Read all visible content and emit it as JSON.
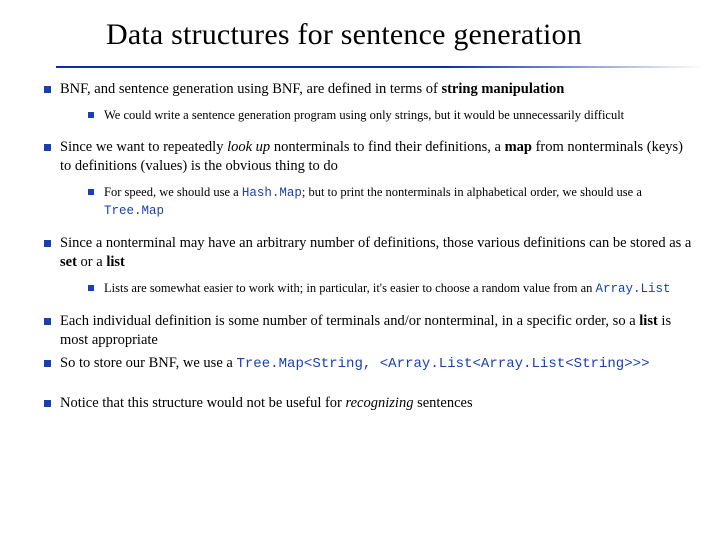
{
  "title": "Data structures for sentence generation",
  "bullets": {
    "b1": {
      "text_a": "BNF, and sentence generation using BNF, are defined in terms of ",
      "text_b": "string manipulation",
      "sub": "We could write a sentence generation program using only strings, but it would be unnecessarily difficult"
    },
    "b2": {
      "text_a": "Since we want to repeatedly ",
      "text_em": "look up",
      "text_b": " nonterminals to find their definitions, a ",
      "text_bold": "map",
      "text_c": " from nonterminals (keys) to definitions (values) is the obvious thing to do",
      "sub_a": "For speed, we should use a ",
      "sub_code1": "Hash.Map",
      "sub_b": "; but to print the nonterminals in alphabetical order, we should use a ",
      "sub_code2": "Tree.Map"
    },
    "b3": {
      "text_a": "Since a nonterminal may have an arbitrary number of definitions, those various definitions can be stored as a ",
      "text_bold1": "set",
      "text_b": " or a ",
      "text_bold2": "list",
      "sub_a": "Lists are somewhat easier to work with; in particular, it's easier to choose a random value from an ",
      "sub_code": "Array.List"
    },
    "b4": {
      "text_a": "Each individual definition is some number of terminals and/or nonterminal, in a specific order, so a ",
      "text_bold": "list",
      "text_b": " is most appropriate"
    },
    "b5": {
      "text_a": "So to store our BNF, we use a ",
      "code": "Tree.Map<String, <Array.List<Array.List<String>>>"
    },
    "b6": {
      "text_a": "Notice that this structure would not be useful for ",
      "text_em": "recognizing",
      "text_b": " sentences"
    }
  }
}
